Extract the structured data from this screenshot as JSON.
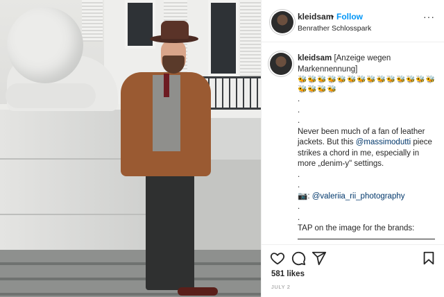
{
  "post": {
    "username": "kleidsam",
    "follow_label": "Follow",
    "dot": "•",
    "location": "Benrather Schlosspark",
    "more_label": "···"
  },
  "caption": {
    "username": "kleidsam",
    "ad_label": "[Anzeige wegen Markennennung]",
    "bees": "🐝🐝🐝🐝🐝🐝🐝🐝🐝🐝🐝🐝🐝🐝🐝🐝🐝🐝",
    "dots_1": ".",
    "dots_2": ".",
    "dots_3": ".",
    "text_1": "Never been much of a fan of leather jackets. But this",
    "mention_1": "@massimodutti",
    "text_2": "piece strikes a chord in me, especially in more „denim-y\" settings.",
    "dots_4": ".",
    "dots_5": ".",
    "camera_emoji": "📷:",
    "mention_2": "@valeriia_rii_photography",
    "dots_6": ".",
    "dots_7": ".",
    "tap_text": "TAP on the image for the brands:"
  },
  "actions": {
    "likes": "581 likes",
    "date": "JULY 2"
  },
  "icons": {
    "heart": "heart-icon",
    "comment": "comment-icon",
    "share": "share-icon",
    "save": "bookmark-icon"
  }
}
